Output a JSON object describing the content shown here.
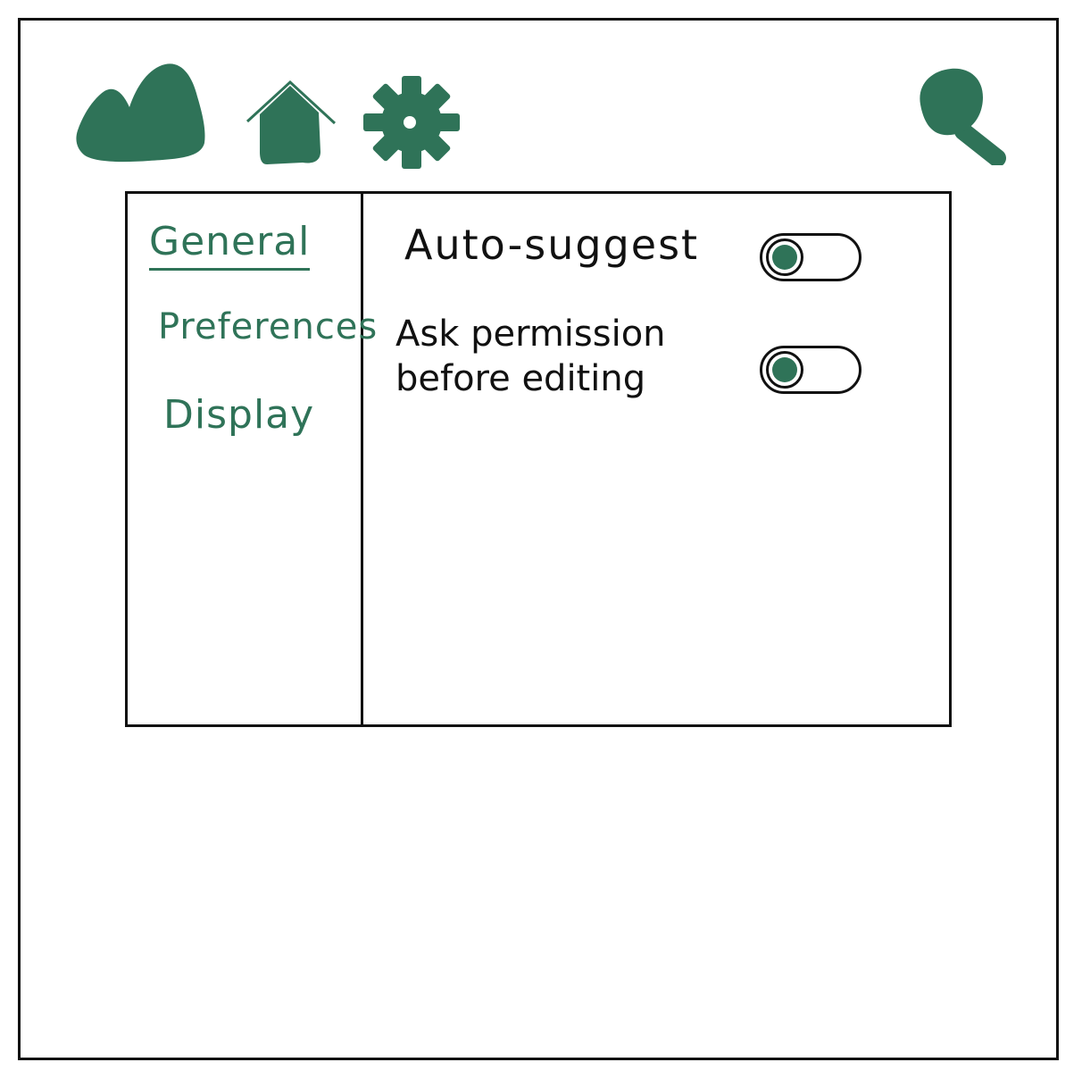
{
  "colors": {
    "accent": "#2f7358",
    "ink": "#111111",
    "background": "#ffffff"
  },
  "toolbar": {
    "icons": [
      "mountain-icon",
      "home-icon",
      "gear-icon",
      "search-icon"
    ]
  },
  "sidebar": {
    "items": [
      {
        "label": "General",
        "active": true
      },
      {
        "label": "Preferences",
        "active": false
      },
      {
        "label": "Display",
        "active": false
      }
    ]
  },
  "settings": [
    {
      "label": "Auto-suggest",
      "toggle_on": false
    },
    {
      "label_lines": [
        "Ask permission",
        "before editing"
      ],
      "toggle_on": false
    }
  ]
}
